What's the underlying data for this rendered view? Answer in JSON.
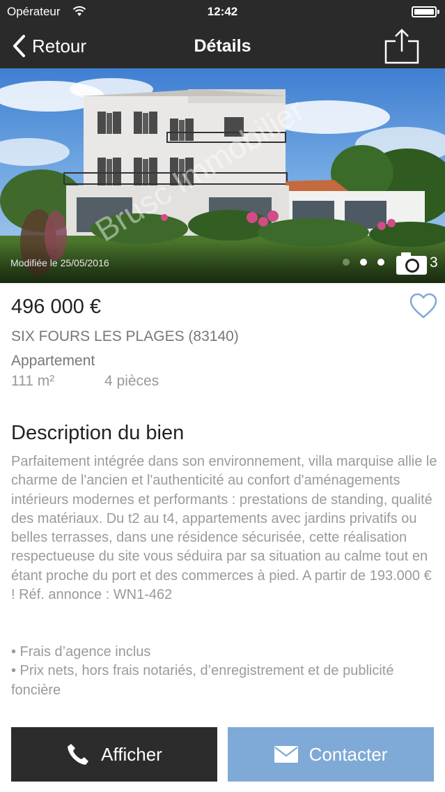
{
  "status_bar": {
    "carrier": "Opérateur",
    "time": "12:42"
  },
  "nav": {
    "back_label": "Retour",
    "title": "Détails"
  },
  "hero": {
    "modified": "Modifiée le 25/05/2016",
    "watermark": "Brusc Immobilier",
    "photo_count": "3",
    "current_photo": 2
  },
  "listing": {
    "price": "496 000 €",
    "city": "SIX FOURS LES PLAGES (83140)",
    "property_type": "Appartement",
    "surface": "111 m²",
    "rooms": "4 pièces",
    "favorite": false
  },
  "description": {
    "title": "Description du bien",
    "text": "Parfaitement intégrée dans son environnement, villa marquise allie le charme de l'ancien et l'authenticité au confort d'aménagements intérieurs modernes et performants : prestations de standing, qualité des matériaux. Du t2 au t4, appartements avec jardins privatifs ou belles terrasses, dans une résidence sécurisée, cette réalisation respectueuse du site vous séduira par sa situation au calme tout en étant proche du port et des commerces à pied. A partir de 193.000 € ! Réf. annonce : WN1-462",
    "bullets": [
      "• Frais d’agence inclus",
      "• Prix nets, hors frais notariés, d’enregistrement et de publicité foncière"
    ]
  },
  "actions": {
    "show_label": "Afficher",
    "contact_label": "Contacter"
  },
  "colors": {
    "bar": "#2a2a2a",
    "contact": "#7fa9d6",
    "favorite": "#7fa9d6"
  }
}
